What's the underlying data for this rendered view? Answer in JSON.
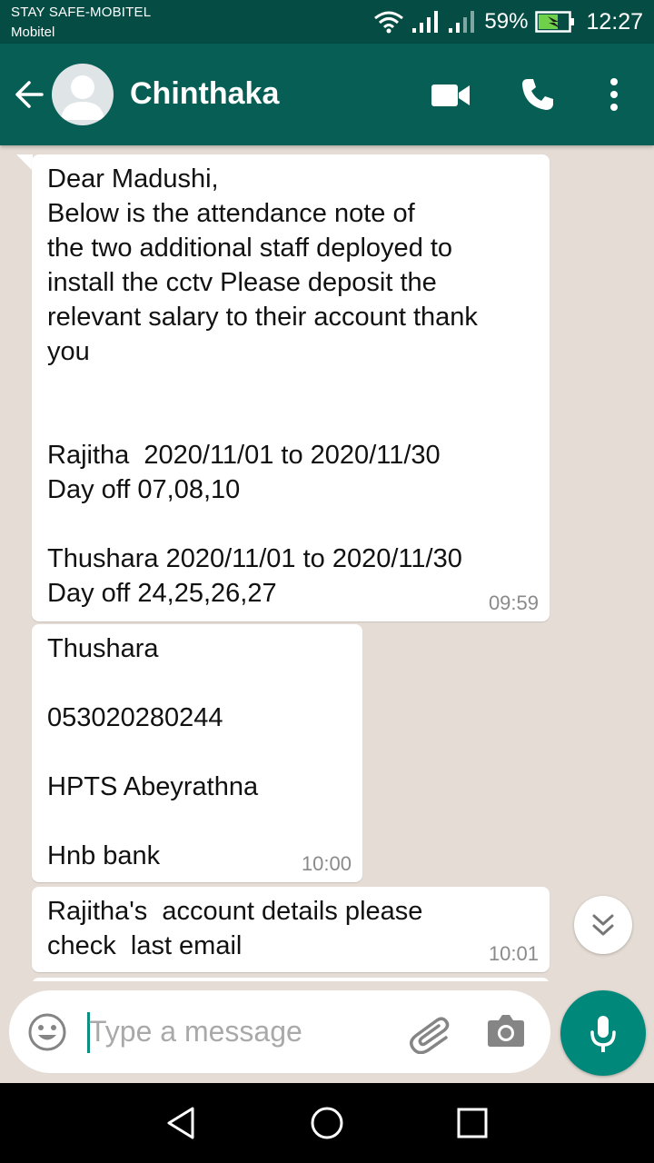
{
  "status_bar": {
    "carrier_line1": "STAY SAFE-MOBITEL",
    "carrier_line2": "Mobitel",
    "battery_percent": "59%",
    "time": "12:27"
  },
  "header": {
    "contact_name": "Chinthaka",
    "icons": [
      "back-arrow-icon",
      "avatar",
      "video-call-icon",
      "phone-call-icon",
      "more-options-icon"
    ]
  },
  "messages": [
    {
      "lines": [
        "Dear Madushi,",
        "Below is the attendance note of",
        "the two additional staff deployed to",
        "install the cctv Please deposit the",
        "relevant salary to their account thank",
        "you",
        "",
        "",
        "Rajitha  2020/11/01 to 2020/11/30",
        "Day off 07,08,10",
        "",
        "Thushara 2020/11/01 to 2020/11/30",
        "Day off 24,25,26,27"
      ],
      "time": "09:59"
    },
    {
      "lines": [
        "Thushara",
        "",
        "053020280244",
        "",
        "HPTS Abeyrathna",
        "",
        "Hnb bank"
      ],
      "time": "10:00"
    },
    {
      "lines": [
        "Rajitha's  account details please",
        "check  last email"
      ],
      "time": "10:01"
    }
  ],
  "composer": {
    "placeholder": "Type a message"
  },
  "colors": {
    "header": "#075e54",
    "status_bar": "#054d44",
    "chat_background": "#e5ddd5",
    "mic_button": "#00897b"
  }
}
